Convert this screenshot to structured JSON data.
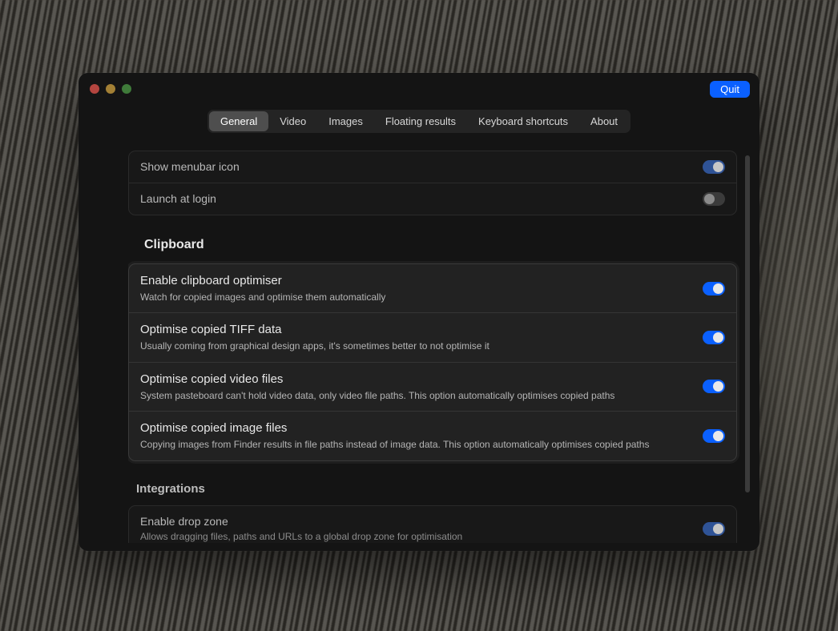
{
  "window": {
    "quit_label": "Quit"
  },
  "tabs": [
    {
      "label": "General",
      "active": true
    },
    {
      "label": "Video",
      "active": false
    },
    {
      "label": "Images",
      "active": false
    },
    {
      "label": "Floating results",
      "active": false
    },
    {
      "label": "Keyboard shortcuts",
      "active": false
    },
    {
      "label": "About",
      "active": false
    }
  ],
  "general": {
    "menubar": {
      "label": "Show menubar icon",
      "value": true
    },
    "launch": {
      "label": "Launch at login",
      "value": false
    }
  },
  "clipboard": {
    "title": "Clipboard",
    "rows": [
      {
        "label": "Enable clipboard optimiser",
        "desc": "Watch for copied images and optimise them automatically",
        "value": true
      },
      {
        "label": "Optimise copied TIFF data",
        "desc": "Usually coming from graphical design apps, it's sometimes better to not optimise it",
        "value": true
      },
      {
        "label": "Optimise copied video files",
        "desc": "System pasteboard can't hold video data, only video file paths. This option automatically optimises copied paths",
        "value": true
      },
      {
        "label": "Optimise copied image files",
        "desc": "Copying images from Finder results in file paths instead of image data. This option automatically optimises copied paths",
        "value": true
      }
    ]
  },
  "integrations": {
    "title": "Integrations",
    "dropzone": {
      "label": "Enable drop zone",
      "desc": "Allows dragging files, paths and URLs to a global drop zone for optimisation",
      "value": true
    }
  }
}
